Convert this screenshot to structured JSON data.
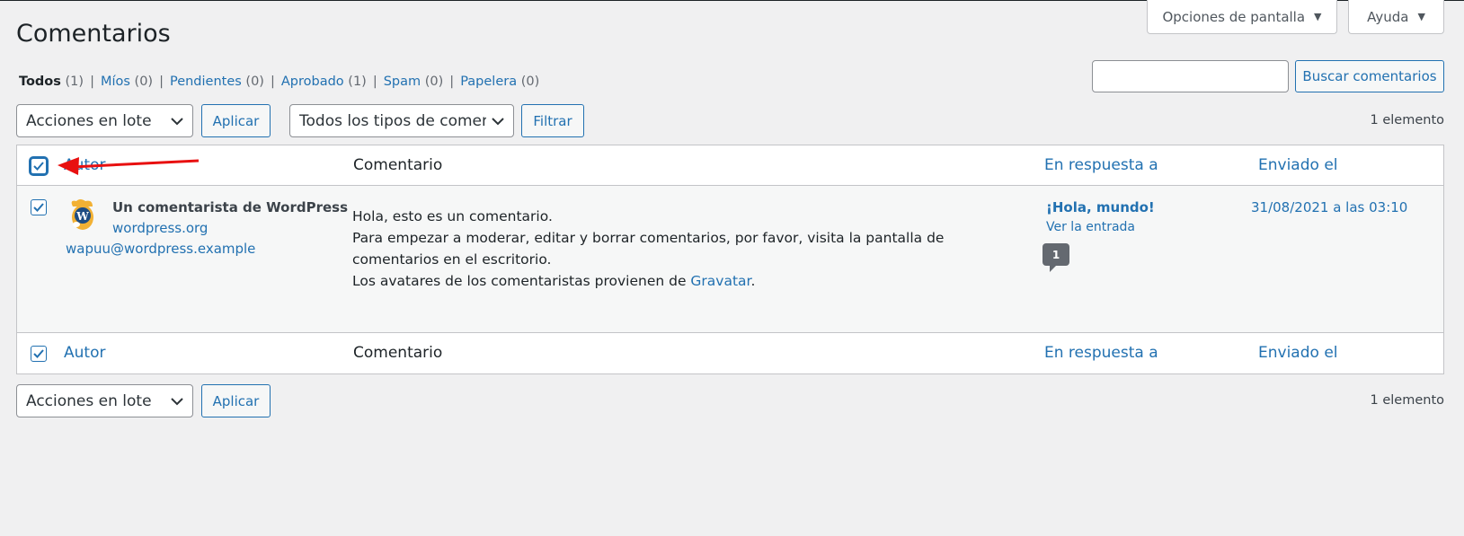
{
  "screen_options": {
    "label": "Opciones de pantalla"
  },
  "help": {
    "label": "Ayuda"
  },
  "page_title": "Comentarios",
  "filters": [
    {
      "label": "Todos",
      "count": " (1)",
      "current": true
    },
    {
      "label": "Míos",
      "count": " (0)"
    },
    {
      "label": "Pendientes",
      "count": " (0)"
    },
    {
      "label": "Aprobado",
      "count": " (1)"
    },
    {
      "label": "Spam",
      "count": " (0)"
    },
    {
      "label": "Papelera",
      "count": " (0)"
    }
  ],
  "search": {
    "button_label": "Buscar comentarios",
    "value": ""
  },
  "top_nav": {
    "bulk_select": "Acciones en lote",
    "apply_label": "Aplicar",
    "type_select": "Todos los tipos de comentarios",
    "filter_label": "Filtrar",
    "count": "1 elemento"
  },
  "columns": {
    "author": "Autor",
    "comment": "Comentario",
    "response": "En respuesta a",
    "date": "Enviado el"
  },
  "comment": {
    "author_name": "Un comentarista de WordPress",
    "author_url": "wordpress.org",
    "author_email": "wapuu@wordpress.example",
    "line1": "Hola, esto es un comentario.",
    "line2": "Para empezar a moderar, editar y borrar comentarios, por favor, visita la pantalla de comentarios en el escritorio.",
    "line3_prefix": "Los avatares de los comentaristas provienen de ",
    "line3_link": "Gravatar",
    "line3_suffix": ".",
    "post_title": "¡Hola, mundo!",
    "view_post": "Ver la entrada",
    "comment_count": "1",
    "date": "31/08/2021 a las 03:10"
  },
  "bottom_nav": {
    "bulk_select": "Acciones en lote",
    "apply_label": "Aplicar",
    "count": "1 elemento"
  },
  "colors": {
    "link": "#2271b1",
    "annotation_arrow": "#e81010"
  }
}
